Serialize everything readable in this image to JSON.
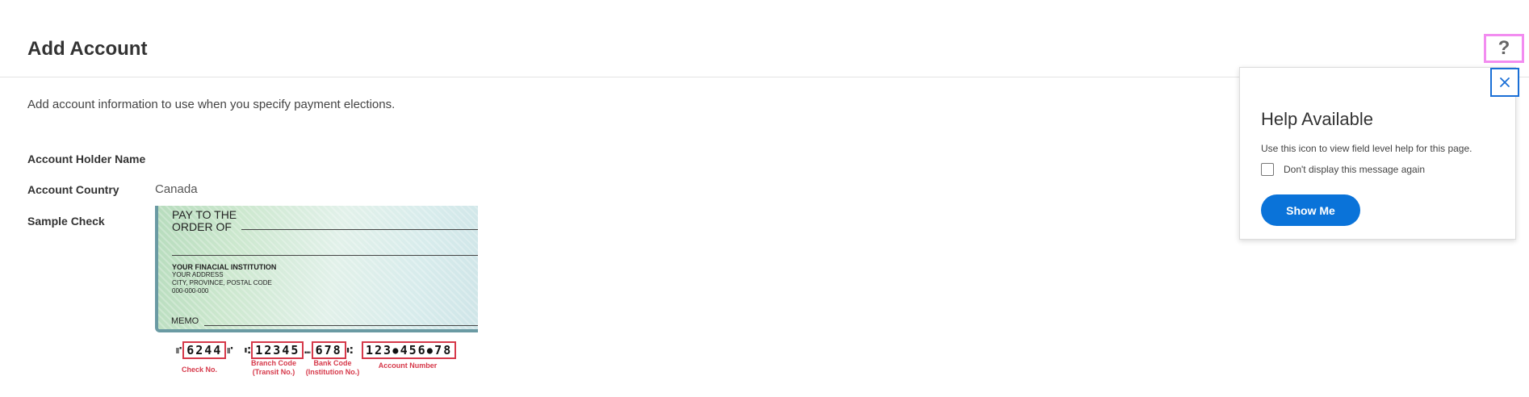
{
  "header": {
    "title": "Add Account",
    "help_icon": "question-mark-icon",
    "help_glyph": "?"
  },
  "intro": "Add account information to use when you specify payment elections.",
  "fields": {
    "holder_name": {
      "label": "Account Holder Name",
      "value": ""
    },
    "country": {
      "label": "Account Country",
      "value": "Canada"
    },
    "sample_check": {
      "label": "Sample Check"
    }
  },
  "check": {
    "pay_to_1": "PAY TO THE",
    "pay_to_2": "ORDER OF",
    "bank_name": "YOUR FINACIAL INSTITUTION",
    "bank_address": "YOUR ADDRESS",
    "bank_city": "CITY, PROVINCE, POSTAL CODE",
    "bank_phone": "000-000-000",
    "memo": "MEMO",
    "micr": {
      "check_no": "6244",
      "branch": "12345",
      "bank": "678",
      "account": "123⦁456⦁78"
    },
    "captions": {
      "check_no": "Check No.",
      "branch_1": "Branch Code",
      "branch_2": "(Transit No.)",
      "bank_1": "Bank Code",
      "bank_2": "(Institution No.)",
      "account": "Account Number"
    }
  },
  "popup": {
    "title": "Help Available",
    "text": "Use this icon to view field level help for this page.",
    "checkbox_label": "Don't display this message again",
    "checkbox_checked": false,
    "button": "Show Me",
    "close_icon": "close-icon"
  },
  "colors": {
    "accent": "#0a73d9",
    "highlight": "#f28cf0",
    "micr_box": "#d6394a"
  }
}
